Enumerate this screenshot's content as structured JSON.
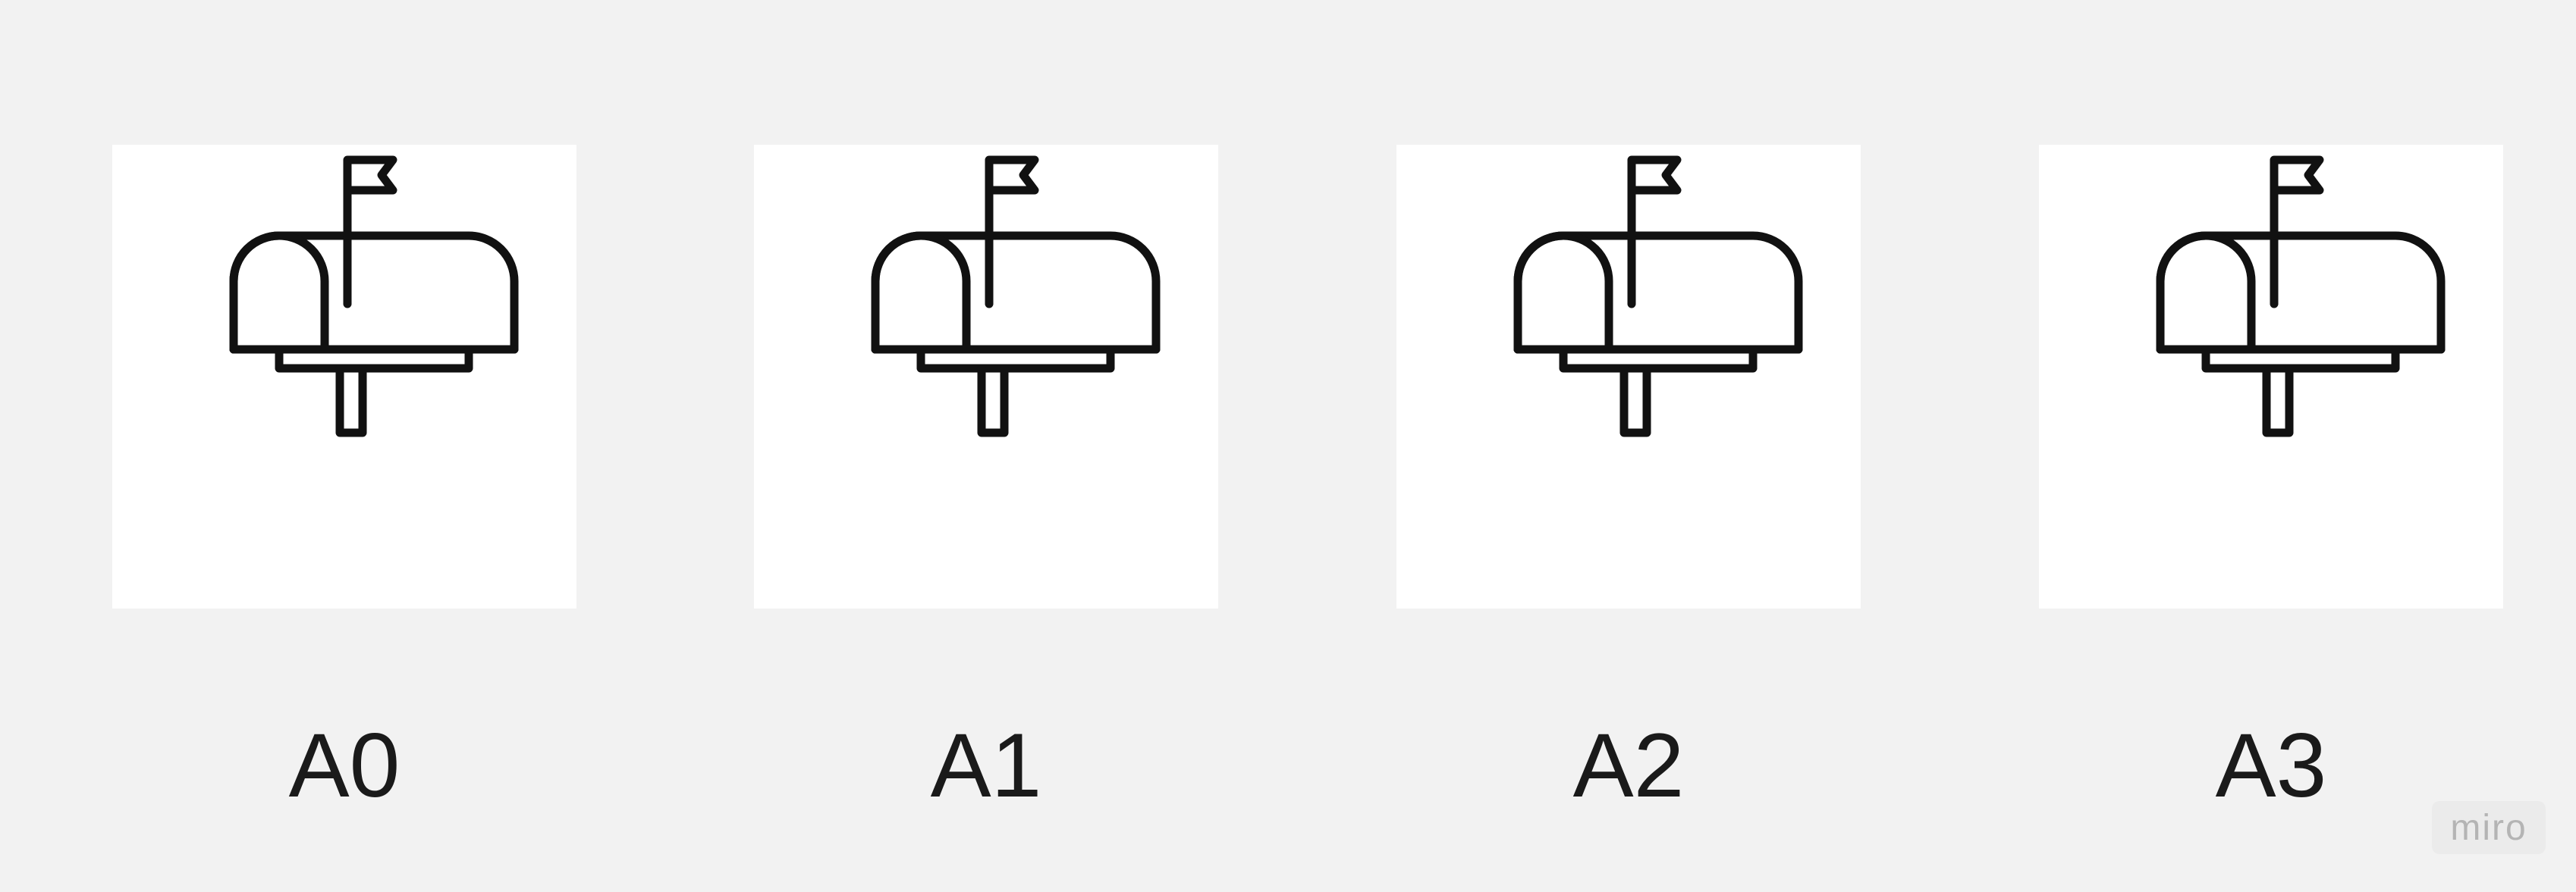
{
  "cards": [
    {
      "label": "A0",
      "icon": "mailbox-icon"
    },
    {
      "label": "A1",
      "icon": "mailbox-icon"
    },
    {
      "label": "A2",
      "icon": "mailbox-icon"
    },
    {
      "label": "A3",
      "icon": "mailbox-icon"
    }
  ],
  "watermark": "miro",
  "colors": {
    "background": "#f2f2f2",
    "card": "#ffffff",
    "icon_stroke": "#111111",
    "label_text": "#1a1a1a",
    "watermark_text": "#b4b4b4"
  }
}
